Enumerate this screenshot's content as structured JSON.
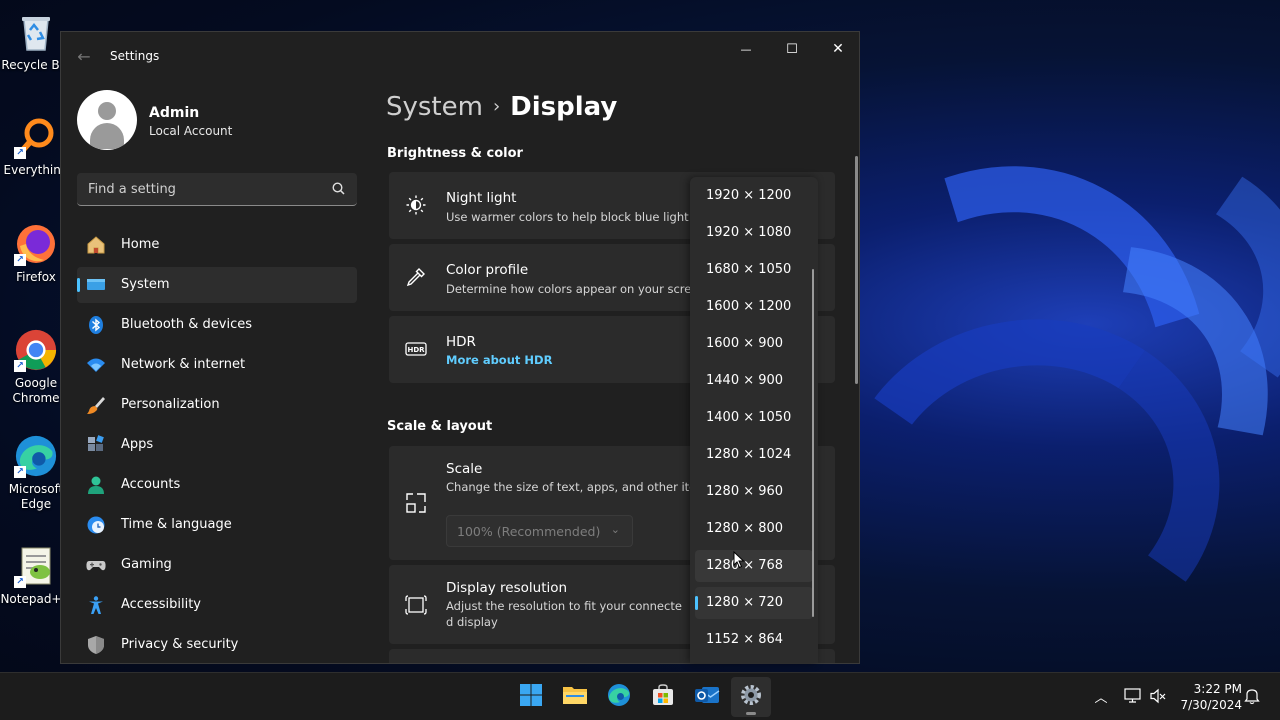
{
  "desktop": {
    "icons": [
      {
        "label": "Recycle Bin",
        "icon": "recycle-bin-icon"
      },
      {
        "label": "Everything",
        "icon": "everything-icon"
      },
      {
        "label": "Firefox",
        "icon": "firefox-icon"
      },
      {
        "label": "Google Chrome",
        "icon": "chrome-icon"
      },
      {
        "label": "Microsoft Edge",
        "icon": "edge-icon"
      },
      {
        "label": "Notepad++",
        "icon": "notepadpp-icon"
      }
    ]
  },
  "window": {
    "title": "Settings",
    "back": "←",
    "minimize": "—",
    "maximize": "☐",
    "close": "✕"
  },
  "user": {
    "name": "Admin",
    "account_type": "Local Account"
  },
  "search": {
    "placeholder": "Find a setting"
  },
  "nav": [
    {
      "label": "Home",
      "icon": "home-icon"
    },
    {
      "label": "System",
      "icon": "system-icon",
      "active": true
    },
    {
      "label": "Bluetooth & devices",
      "icon": "bluetooth-icon"
    },
    {
      "label": "Network & internet",
      "icon": "wifi-icon"
    },
    {
      "label": "Personalization",
      "icon": "brush-icon"
    },
    {
      "label": "Apps",
      "icon": "apps-icon"
    },
    {
      "label": "Accounts",
      "icon": "accounts-icon"
    },
    {
      "label": "Time & language",
      "icon": "time-language-icon"
    },
    {
      "label": "Gaming",
      "icon": "gamepad-icon"
    },
    {
      "label": "Accessibility",
      "icon": "accessibility-icon"
    },
    {
      "label": "Privacy & security",
      "icon": "shield-icon"
    }
  ],
  "breadcrumb": {
    "parent": "System",
    "separator": "›",
    "current": "Display"
  },
  "sections": {
    "brightness": "Brightness & color",
    "scale_layout": "Scale & layout"
  },
  "cards": {
    "night_light": {
      "title": "Night light",
      "desc": "Use warmer colors to help block blue light",
      "icon": "sun-icon"
    },
    "color_profile": {
      "title": "Color profile",
      "desc": "Determine how colors appear on your screen",
      "icon": "eyedropper-icon"
    },
    "hdr": {
      "title": "HDR",
      "link": "More about HDR",
      "icon": "hdr-icon"
    },
    "scale": {
      "title": "Scale",
      "desc": "Change the size of text, apps, and other items",
      "select_value": "100% (Recommended)",
      "icon": "scale-icon"
    },
    "resolution": {
      "title": "Display resolution",
      "desc_line1": "Adjust the resolution to fit your connecte",
      "desc_line2": "d display",
      "icon": "resolution-icon"
    }
  },
  "resolution_dropdown": {
    "options": [
      "1920 × 1200",
      "1920 × 1080",
      "1680 × 1050",
      "1600 × 1200",
      "1600 × 900",
      "1440 × 900",
      "1400 × 1050",
      "1280 × 1024",
      "1280 × 960",
      "1280 × 800",
      "1280 × 768",
      "1280 × 720",
      "1152 × 864"
    ],
    "selected": "1280 × 720",
    "hovered": "1280 × 768"
  },
  "taskbar": {
    "apps": [
      {
        "icon": "start-icon"
      },
      {
        "icon": "file-explorer-icon"
      },
      {
        "icon": "edge-icon"
      },
      {
        "icon": "store-icon"
      },
      {
        "icon": "outlook-icon"
      },
      {
        "icon": "settings-icon",
        "active": true
      }
    ],
    "tray": {
      "chevron": "︿",
      "time": "3:22 PM",
      "date": "7/30/2024"
    }
  },
  "colors": {
    "accent": "#4cc2ff",
    "link": "#60cdff",
    "window_bg": "#202020",
    "card_bg": "#2b2b2b"
  }
}
